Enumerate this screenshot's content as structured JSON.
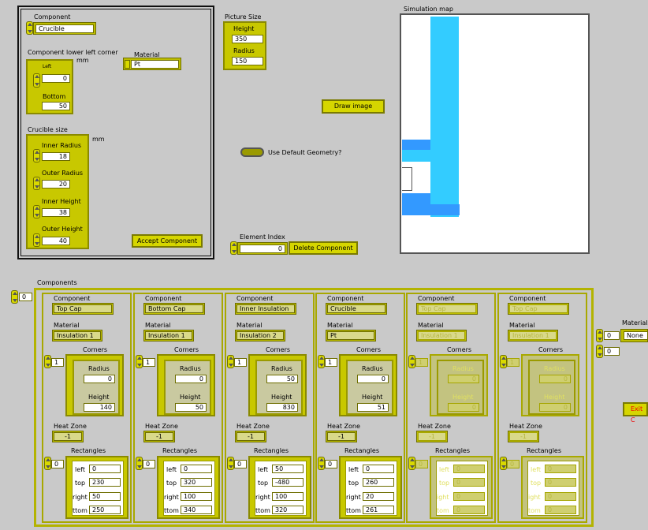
{
  "top_cluster": {
    "component_label": "Component",
    "component_value": "Crucible",
    "material_label": "Material",
    "material_value": "Pt",
    "corner_label": "Component lower left corner",
    "corner_unit": "mm",
    "left_label": "Left",
    "left_value": "0",
    "bottom_label": "Bottom",
    "bottom_value": "50",
    "crucible_size_label": "Crucible size",
    "crucible_unit": "mm",
    "inner_radius_label": "Inner Radius",
    "inner_radius_value": "18",
    "outer_radius_label": "Outer Radius",
    "outer_radius_value": "20",
    "inner_height_label": "Inner Height",
    "inner_height_value": "38",
    "outer_height_label": "Outer Height",
    "outer_height_value": "40",
    "accept_button": "Accept Component"
  },
  "picture_size": {
    "label": "Picture Size",
    "height_label": "Height",
    "height_value": "350",
    "radius_label": "Radius",
    "radius_value": "150"
  },
  "draw_button": "Draw image",
  "default_geometry_label": "Use Default Geometry?",
  "element_index": {
    "label": "Element Index",
    "value": "0",
    "delete_button": "Delete Component"
  },
  "sim_map": {
    "label": "Simulation map"
  },
  "components": {
    "label": "Components",
    "index": "0",
    "items": [
      {
        "component_label": "Component",
        "component": "Top Cap",
        "material_label": "Material",
        "material": "Insulation 1",
        "corners_label": "Corners",
        "corners_index": "1",
        "radius_label": "Radius",
        "radius": "0",
        "height_label": "Height",
        "height": "140",
        "heat_zone_label": "Heat Zone",
        "heat_zone": "-1",
        "rect_label": "Rectangles",
        "rect_index": "0",
        "left_label": "left",
        "left": "0",
        "top_label": "top",
        "top": "230",
        "right_label": "right",
        "right": "50",
        "bottom_label": "ttom",
        "bottom": "250"
      },
      {
        "component_label": "Component",
        "component": "Bottom Cap",
        "material_label": "Material",
        "material": "Insulation 1",
        "corners_label": "Corners",
        "corners_index": "1",
        "radius_label": "Radius",
        "radius": "0",
        "height_label": "Height",
        "height": "50",
        "heat_zone_label": "Heat Zone",
        "heat_zone": "-1",
        "rect_label": "Rectangles",
        "rect_index": "0",
        "left_label": "left",
        "left": "0",
        "top_label": "top",
        "top": "320",
        "right_label": "right",
        "right": "100",
        "bottom_label": "ttom",
        "bottom": "340"
      },
      {
        "component_label": "Component",
        "component": "Inner Insulation",
        "material_label": "Material",
        "material": "Insulation 2",
        "corners_label": "Corners",
        "corners_index": "1",
        "radius_label": "Radius",
        "radius": "50",
        "height_label": "Height",
        "height": "830",
        "heat_zone_label": "Heat Zone",
        "heat_zone": "-1",
        "rect_label": "Rectangles",
        "rect_index": "0",
        "left_label": "left",
        "left": "50",
        "top_label": "top",
        "top": "-480",
        "right_label": "right",
        "right": "100",
        "bottom_label": "ttom",
        "bottom": "320"
      },
      {
        "component_label": "Component",
        "component": "Crucible",
        "material_label": "Material",
        "material": "Pt",
        "corners_label": "Corners",
        "corners_index": "1",
        "radius_label": "Radius",
        "radius": "0",
        "height_label": "Height",
        "height": "51",
        "heat_zone_label": "Heat Zone",
        "heat_zone": "-1",
        "rect_label": "Rectangles",
        "rect_index": "0",
        "left_label": "left",
        "left": "0",
        "top_label": "top",
        "top": "260",
        "right_label": "right",
        "right": "20",
        "bottom_label": "ttom",
        "bottom": "261"
      },
      {
        "component_label": "Component",
        "component": "Top Cap",
        "material_label": "Material",
        "material": "Insulation 1",
        "corners_label": "Corners",
        "corners_index": "1",
        "radius_label": "Radius",
        "radius": "0",
        "height_label": "Height",
        "height": "0",
        "heat_zone_label": "Heat Zone",
        "heat_zone": "-1",
        "rect_label": "Rectangles",
        "rect_index": "0",
        "left_label": "left",
        "left": "0",
        "top_label": "top",
        "top": "0",
        "right_label": "ight",
        "right": "0",
        "bottom_label": "tom",
        "bottom": "0",
        "disabled": true
      },
      {
        "component_label": "Component",
        "component": "Top Cap",
        "material_label": "Material",
        "material": "Insulation 1",
        "corners_label": "Corners",
        "corners_index": "1",
        "radius_label": "Radius",
        "radius": "0",
        "height_label": "Height",
        "height": "0",
        "heat_zone_label": "Heat Zone",
        "heat_zone": "-1",
        "rect_label": "Rectangles",
        "rect_index": "0",
        "left_label": "left",
        "left": "0",
        "top_label": "top",
        "top": "0",
        "right_label": "ight",
        "right": "0",
        "bottom_label": "tom",
        "bottom": "0",
        "disabled": true
      }
    ]
  },
  "materials": {
    "label": "Materials",
    "index1": "0",
    "index2": "0",
    "value": "None"
  },
  "exit_button": "Exit C",
  "colors": {
    "olive": "#bdbd00",
    "cyan": "#33ccff",
    "blue": "#3399ff",
    "bg": "#c9c9c9"
  }
}
